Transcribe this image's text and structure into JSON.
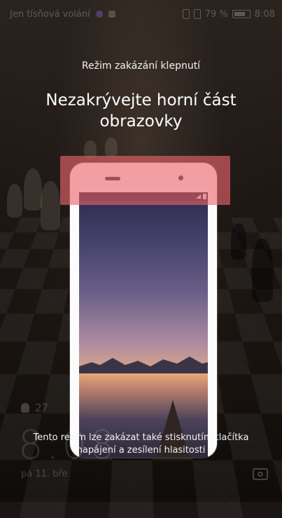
{
  "status_bar": {
    "carrier_text": "Jen tísňová volání",
    "battery_percent": "79 %",
    "time": "8:08",
    "icons": [
      "notification-icon",
      "app-icon",
      "sim-icon",
      "battery-icon"
    ]
  },
  "overlay": {
    "mode_title": "Režim zakázání klepnutí",
    "headline": "Nezakrývejte horní část obrazovky",
    "hint_line1": "Tento režim lze zakázat také stisknutím tlačítka",
    "hint_line2": "napájení a zesílení hlasitosti",
    "highlight_color": "#ec666e"
  },
  "lockscreen": {
    "steps": "27",
    "clock": "8:08",
    "date": "pá 11. bře",
    "camera_icon": "camera-icon"
  }
}
